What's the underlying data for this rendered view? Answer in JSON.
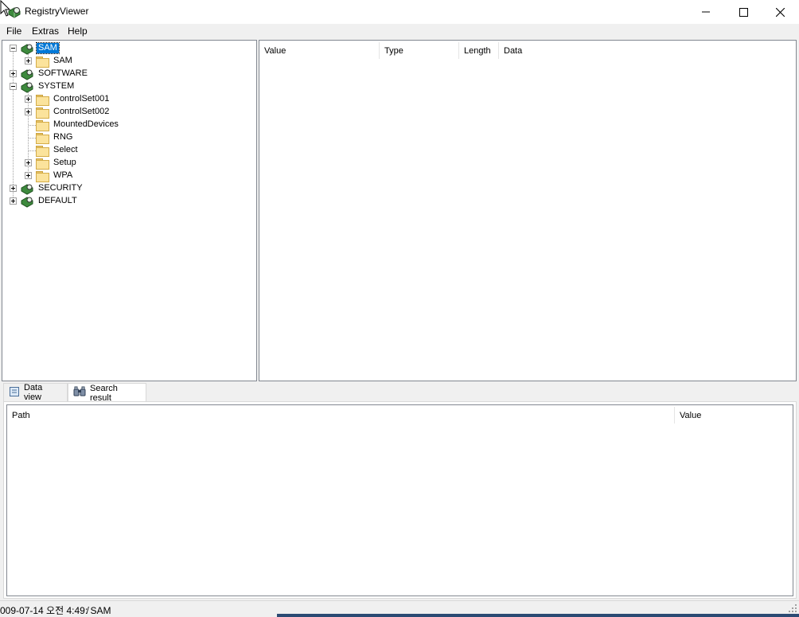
{
  "window": {
    "title": "RegistryViewer",
    "controls": [
      "minimize",
      "maximize",
      "close"
    ]
  },
  "menu": {
    "items": [
      "File",
      "Extras",
      "Help"
    ]
  },
  "tree": {
    "nodes": [
      {
        "label": "SAM",
        "icon": "registry-hive-icon",
        "selected": true
      },
      {
        "label": "SAM",
        "icon": "folder-icon"
      },
      {
        "label": "SOFTWARE",
        "icon": "registry-hive-icon"
      },
      {
        "label": "SYSTEM",
        "icon": "registry-hive-icon"
      },
      {
        "label": "ControlSet001",
        "icon": "folder-icon"
      },
      {
        "label": "ControlSet002",
        "icon": "folder-icon"
      },
      {
        "label": "MountedDevices",
        "icon": "folder-icon"
      },
      {
        "label": "RNG",
        "icon": "folder-icon"
      },
      {
        "label": "Select",
        "icon": "folder-icon"
      },
      {
        "label": "Setup",
        "icon": "folder-icon"
      },
      {
        "label": "WPA",
        "icon": "folder-icon"
      },
      {
        "label": "SECURITY",
        "icon": "registry-hive-icon"
      },
      {
        "label": "DEFAULT",
        "icon": "registry-hive-icon"
      }
    ]
  },
  "values_list": {
    "columns": [
      "Value",
      "Type",
      "Length",
      "Data"
    ]
  },
  "tabs": {
    "items": [
      "Data view",
      "Search result"
    ],
    "active": "Search result"
  },
  "search_list": {
    "columns": [
      "Path",
      "Value"
    ]
  },
  "status": {
    "text": "009-07-14 오전 4:49:̸ SAM"
  },
  "colors": {
    "selection": "#0078d7",
    "border": "#828790",
    "window_bg": "#f0f0f0"
  }
}
